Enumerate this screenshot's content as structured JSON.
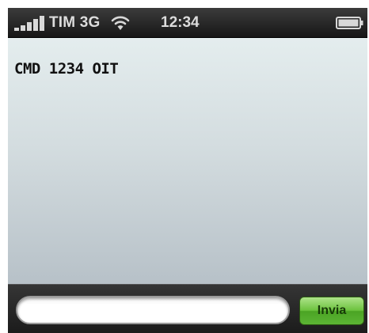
{
  "status_bar": {
    "carrier": "TIM 3G",
    "time": "12:34",
    "signal_icon": "signal-bars-icon",
    "wifi_icon": "wifi-icon",
    "battery_icon": "battery-icon",
    "battery_level": 1.0
  },
  "conversation": {
    "message": "CMD 1234 OIT"
  },
  "composer": {
    "input_value": "",
    "input_placeholder": "",
    "send_label": "Invia"
  },
  "colors": {
    "status_text": "#dcdcdc",
    "send_button_green": "#6dc33f",
    "background_top": "#e4edee",
    "background_bottom": "#b7c1c8"
  }
}
